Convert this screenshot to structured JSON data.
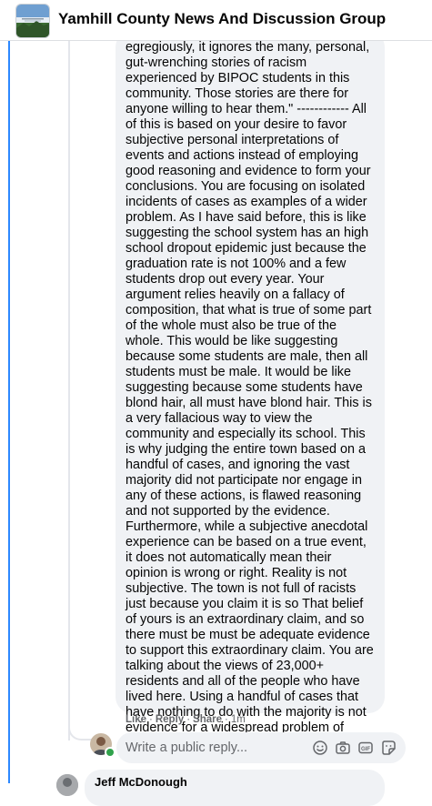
{
  "header": {
    "group_title": "Yamhill County News And Discussion Group",
    "group_avatar_icon": "group-cover-thumbnail"
  },
  "comment": {
    "text": "egregiously, it ignores the many, personal, gut-wrenching stories of racism experienced by BIPOC students in this community. Those stories are there for anyone willing to hear them.\" ------------ All of this is based on your desire to favor subjective personal interpretations of events and actions instead of employing good reasoning and evidence to form your conclusions. You are focusing on isolated incidents of cases as examples of a wider problem. As I have said before, this is like suggesting the school system has an high school dropout epidemic just because the graduation rate is not 100% and a few students drop out every year. Your argument relies heavily on a fallacy of composition, that what is true of some part of the whole must also be true of the whole. This would be like suggesting because some students are male, then all students must be male. It would be like suggesting because some students have blond hair, all must have blond hair. This is a very fallacious way to view the community and especially its school. This is why judging the entire town based on a handful of cases, and ignoring the vast majority did not participate nor engage in any of these actions, is flawed reasoning and not supported by the evidence. Furthermore, while a subjective anecdotal experience can be based on a true event, it does not automatically mean their opinion is wrong or right. Reality is not subjective. The town is not full of racists just because you claim it is so That belief of yours is an extraordinary claim, and so there must be must be adequate evidence to support this extraordinary claim. You are talking about the views of 23,000+ residents and all of the people who have lived here. Using a handful of cases that have nothing to do with the majority is not evidence for a widespread problem of racism. The facts do not support your assertions here.",
    "actions": {
      "like": "Like",
      "reply": "Reply",
      "share": "Share",
      "separator": "·",
      "time": "1m"
    }
  },
  "reply_box": {
    "placeholder": "Write a public reply...",
    "icons": [
      "emoji-icon",
      "camera-icon",
      "gif-icon",
      "sticker-icon"
    ]
  },
  "next_comment": {
    "author": "Jeff McDonough"
  },
  "colors": {
    "thread_accent": "#2d88ff",
    "bubble_bg": "#f0f2f5",
    "secondary_text": "#65676b",
    "online": "#31a24c"
  }
}
